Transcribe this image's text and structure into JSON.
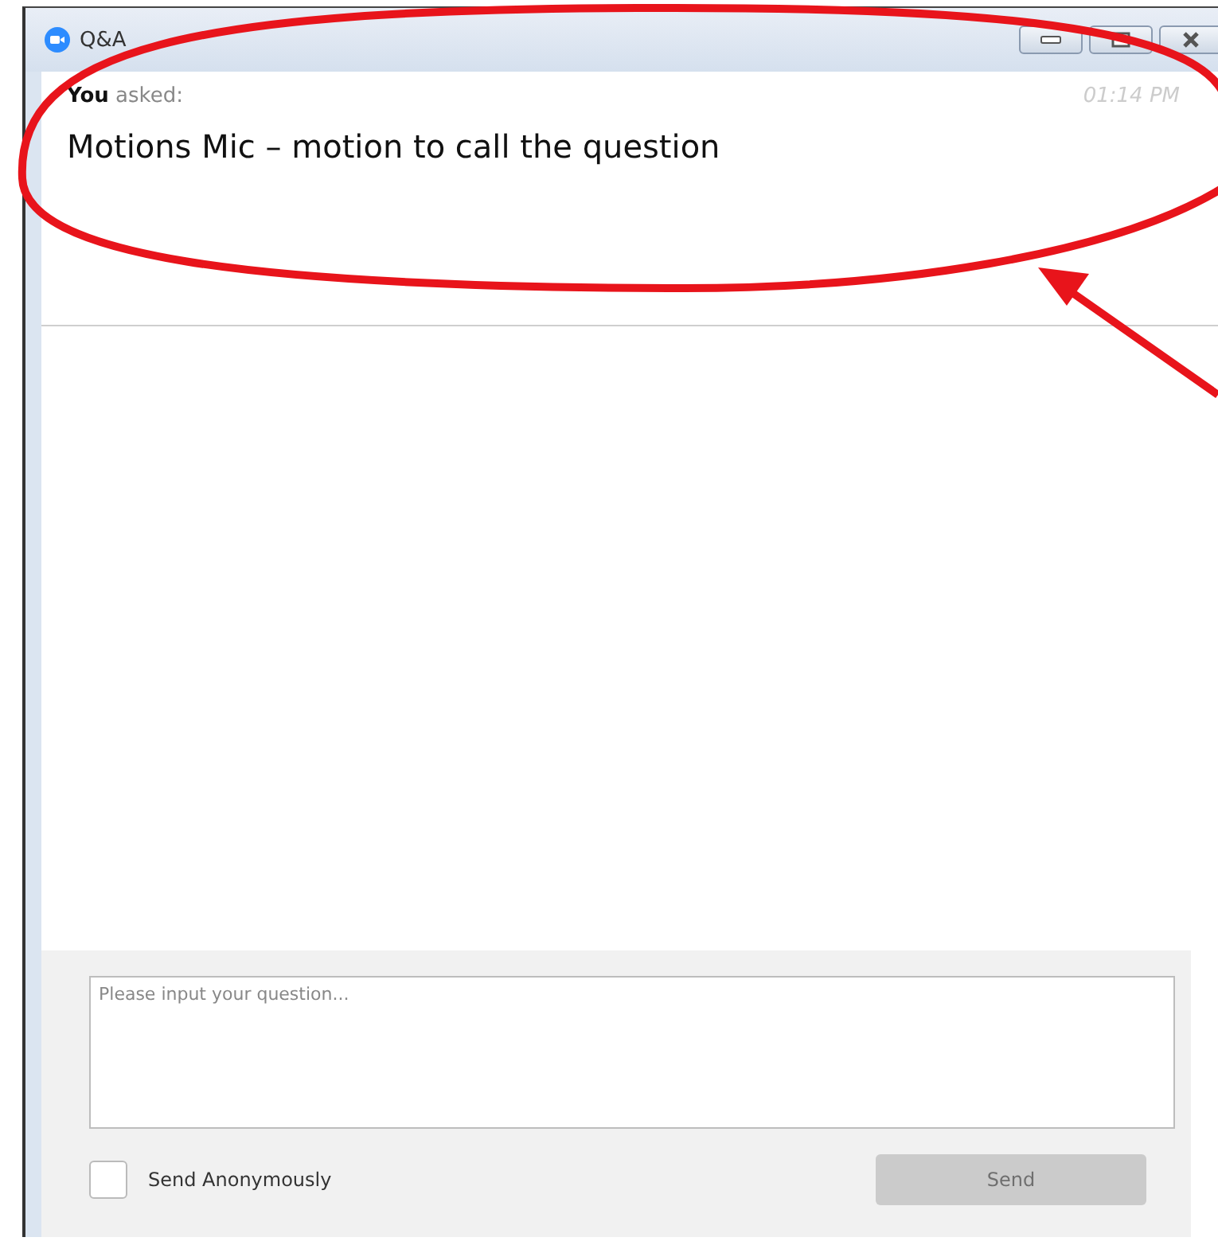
{
  "window": {
    "title": "Q&A"
  },
  "message": {
    "author": "You",
    "verb": "asked:",
    "time": "01:14 PM",
    "text": "Motions Mic – motion to call the question"
  },
  "composer": {
    "placeholder": "Please input your question...",
    "anonymous": {
      "label": "Send Anonymously",
      "checked": false
    },
    "send": {
      "label": "Send",
      "disabled": true
    }
  },
  "annotations": {
    "highlight_ellipse": true,
    "pointer_arrow": true
  }
}
